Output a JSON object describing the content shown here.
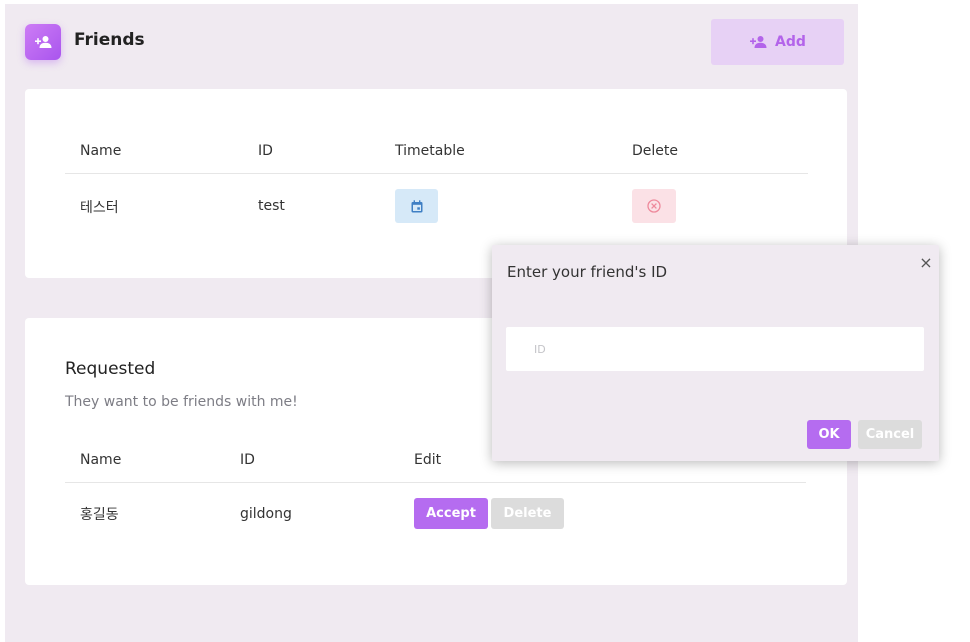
{
  "header": {
    "title": "Friends",
    "app_icon": "person-add-icon",
    "add_label": "Add",
    "add_icon": "person-add-icon"
  },
  "friends": {
    "columns": [
      "Name",
      "ID",
      "Timetable",
      "Delete"
    ],
    "rows": [
      {
        "name": "테스터",
        "id": "test",
        "timetable_icon": "calendar-icon",
        "delete_icon": "circle-x-icon"
      }
    ]
  },
  "requested": {
    "title": "Requested",
    "subtitle": "They want to be friends with me!",
    "columns": [
      "Name",
      "ID",
      "Edit"
    ],
    "rows": [
      {
        "name": "홍길동",
        "id": "gildong",
        "accept_label": "Accept",
        "delete_label": "Delete"
      }
    ]
  },
  "modal": {
    "title": "Enter your friend's ID",
    "close_label": "×",
    "input_value": "",
    "input_placeholder": "ID",
    "ok_label": "OK",
    "cancel_label": "Cancel"
  },
  "colors": {
    "accent": "#b56cf0",
    "panel_bg": "#f0eaf1",
    "timetable_bg": "#d6e9f8",
    "delete_bg": "#fbe1e6"
  }
}
